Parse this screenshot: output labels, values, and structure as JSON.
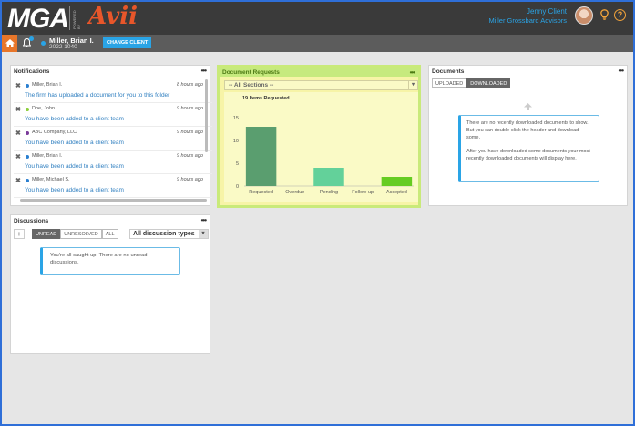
{
  "header": {
    "logo_text": "MGA",
    "powered_by": "POWERED BY",
    "brand_text": "Avii",
    "user_name": "Jenny Client",
    "user_firm": "Miller Grossbard Advisors",
    "bulb_icon": "lightbulb-icon",
    "help_symbol": "?"
  },
  "subbar": {
    "client_name": "Miller, Brian I.",
    "client_id": "2022 1040",
    "change_client_label": "CHANGE CLIENT"
  },
  "notifications": {
    "title": "Notifications",
    "menu": "•••",
    "items": [
      {
        "name": "Miller, Brian I.",
        "time": "8 hours ago",
        "message": "The firm has uploaded a document for you to this folder",
        "dot_color": "#2a7fd0"
      },
      {
        "name": "Doe, John",
        "time": "9 hours ago",
        "message": "You have been added to a client team",
        "dot_color": "#8ccf3a"
      },
      {
        "name": "ABC Company, LLC",
        "time": "9 hours ago",
        "message": "You have been added to a client team",
        "dot_color": "#7a3a9a"
      },
      {
        "name": "Miller, Brian I.",
        "time": "9 hours ago",
        "message": "You have been added to a client team",
        "dot_color": "#2a7fd0"
      },
      {
        "name": "Miller, Michael S.",
        "time": "9 hours ago",
        "message": "You have been added to a client team",
        "dot_color": "#2a7fd0"
      }
    ]
  },
  "doc_requests": {
    "title": "Document Requests",
    "menu": "•••",
    "section_select": "-- All Sections --",
    "items_requested": "19 Items Requested"
  },
  "chart_data": {
    "type": "bar",
    "categories": [
      "Requested",
      "Overdue",
      "Pending",
      "Follow-up",
      "Accepted"
    ],
    "values": [
      13,
      0,
      4,
      0,
      2
    ],
    "colors": [
      "#5a9e6f",
      "#5a9e6f",
      "#63d19a",
      "#63d19a",
      "#66cc22"
    ],
    "ylim": [
      0,
      15
    ],
    "yticks": [
      0,
      5,
      10,
      15
    ],
    "grid": false
  },
  "documents": {
    "title": "Documents",
    "menu": "•••",
    "tabs": [
      "UPLOADED",
      "DOWNLOADED"
    ],
    "active_tab": 1,
    "info_p1": "There are no recently downloaded documents to show. But you can double-click the header and download some.",
    "info_p2": "After you have downloaded some documents your most recently downloaded documents will display here."
  },
  "discussions": {
    "title": "Discussions",
    "menu": "•••",
    "add_label": "+",
    "filters": [
      "UNREAD",
      "UNRESOLVED",
      "ALL"
    ],
    "active_filter": 0,
    "type_select": "All discussion types",
    "info": "You're all caught up. There are no unread discussions."
  }
}
